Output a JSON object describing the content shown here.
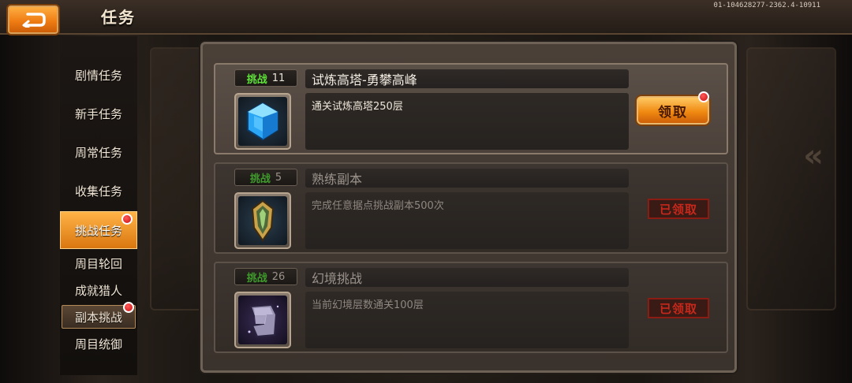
{
  "header": {
    "title": "任务",
    "version": "01-104628277-2362.4-10911"
  },
  "sidebar": {
    "items": [
      {
        "label": "剧情任务",
        "active": false,
        "badge": false
      },
      {
        "label": "新手任务",
        "active": false,
        "badge": false
      },
      {
        "label": "周常任务",
        "active": false,
        "badge": false
      },
      {
        "label": "收集任务",
        "active": false,
        "badge": false
      },
      {
        "label": "挑战任务",
        "active": true,
        "badge": true
      },
      {
        "label": "周目轮回",
        "active": false,
        "badge": false
      },
      {
        "label": "成就猎人",
        "active": false,
        "badge": false
      },
      {
        "label": "副本挑战",
        "active": false,
        "badge": true
      },
      {
        "label": "周目统御",
        "active": false,
        "badge": false
      }
    ]
  },
  "tasks": [
    {
      "tag_label": "挑战",
      "tag_number": "11",
      "title": "试炼高塔-勇攀高峰",
      "description": "通关试炼高塔250层",
      "icon": "blue-crystal-icon",
      "action_label": "领取",
      "claimed": false
    },
    {
      "tag_label": "挑战",
      "tag_number": "5",
      "title": "熟练副本",
      "description": "完成任意据点挑战副本500次",
      "icon": "golden-shield-crystal-icon",
      "status_label": "已领取",
      "claimed": true
    },
    {
      "tag_label": "挑战",
      "tag_number": "26",
      "title": "幻境挑战",
      "description": "当前幻境层数通关100层",
      "icon": "purple-rune-icon",
      "status_label": "已领取",
      "claimed": true
    }
  ],
  "colors": {
    "accent_orange": "#f08a12",
    "tag_green": "#5fe33a",
    "badge_red": "#c8100f",
    "claimed_red": "#c6281c"
  }
}
